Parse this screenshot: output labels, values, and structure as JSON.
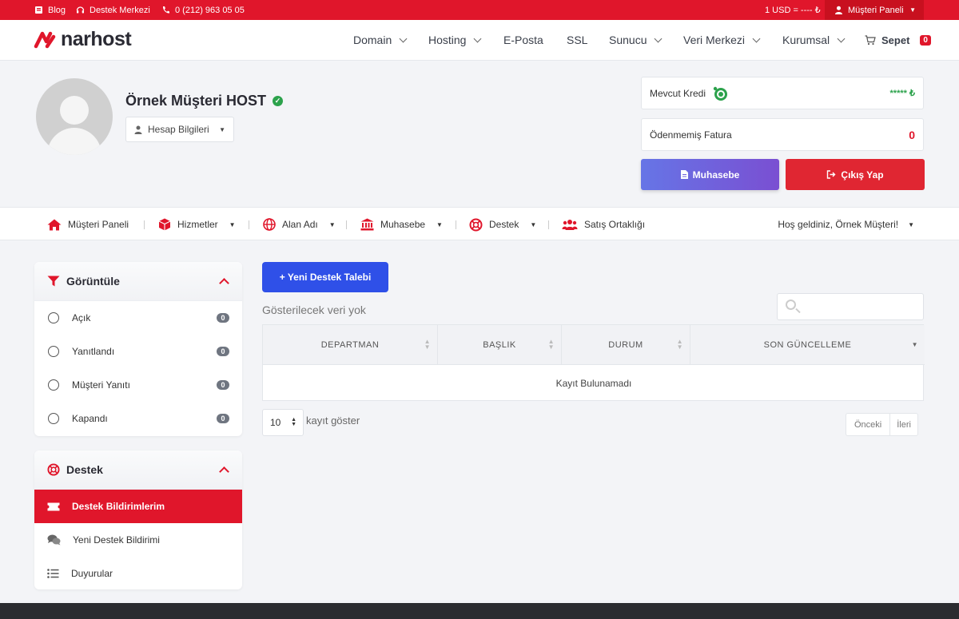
{
  "topbar": {
    "blog": "Blog",
    "support": "Destek Merkezi",
    "phone": "0 (212) 963 05 05",
    "currency": "1 USD = ---- ₺",
    "panel": "Müşteri Paneli"
  },
  "brand": {
    "name": "narhost",
    "color": "#e0162b"
  },
  "nav": {
    "domain": "Domain",
    "hosting": "Hosting",
    "eposta": "E-Posta",
    "ssl": "SSL",
    "sunucu": "Sunucu",
    "veri": "Veri Merkezi",
    "kurumsal": "Kurumsal",
    "cart": "Sepet",
    "cart_count": "0"
  },
  "profile": {
    "name": "Örnek Müşteri HOST",
    "account": "Hesap Bilgileri",
    "credit_label": "Mevcut Kredi",
    "credit_value": "***** ₺",
    "unpaid_label": "Ödenmemiş Fatura",
    "unpaid_value": "0",
    "accounting_btn": "Muhasebe",
    "logout_btn": "Çıkış Yap"
  },
  "menu": {
    "panel": "Müşteri Paneli",
    "services": "Hizmetler",
    "domain": "Alan Adı",
    "accounting": "Muhasebe",
    "support": "Destek",
    "affiliate": "Satış Ortaklığı",
    "welcome": "Hoş geldiniz, Örnek Müşteri!"
  },
  "filter": {
    "title": "Görüntüle",
    "items": [
      {
        "label": "Açık",
        "count": "0"
      },
      {
        "label": "Yanıtlandı",
        "count": "0"
      },
      {
        "label": "Müşteri Yanıtı",
        "count": "0"
      },
      {
        "label": "Kapandı",
        "count": "0"
      }
    ]
  },
  "support": {
    "title": "Destek",
    "items": [
      {
        "label": "Destek Bildirimlerim"
      },
      {
        "label": "Yeni Destek Bildirimi"
      },
      {
        "label": "Duyurular"
      }
    ]
  },
  "tickets": {
    "new_btn": "+ Yeni Destek Talebi",
    "no_data": "Gösterilecek veri yok",
    "columns": [
      "DEPARTMAN",
      "BAŞLIK",
      "DURUM",
      "SON GÜNCELLEME"
    ],
    "empty": "Kayıt Bulunamadı",
    "page_size": "10",
    "show_label": "kayıt göster",
    "prev": "Önceki",
    "next": "İleri"
  }
}
